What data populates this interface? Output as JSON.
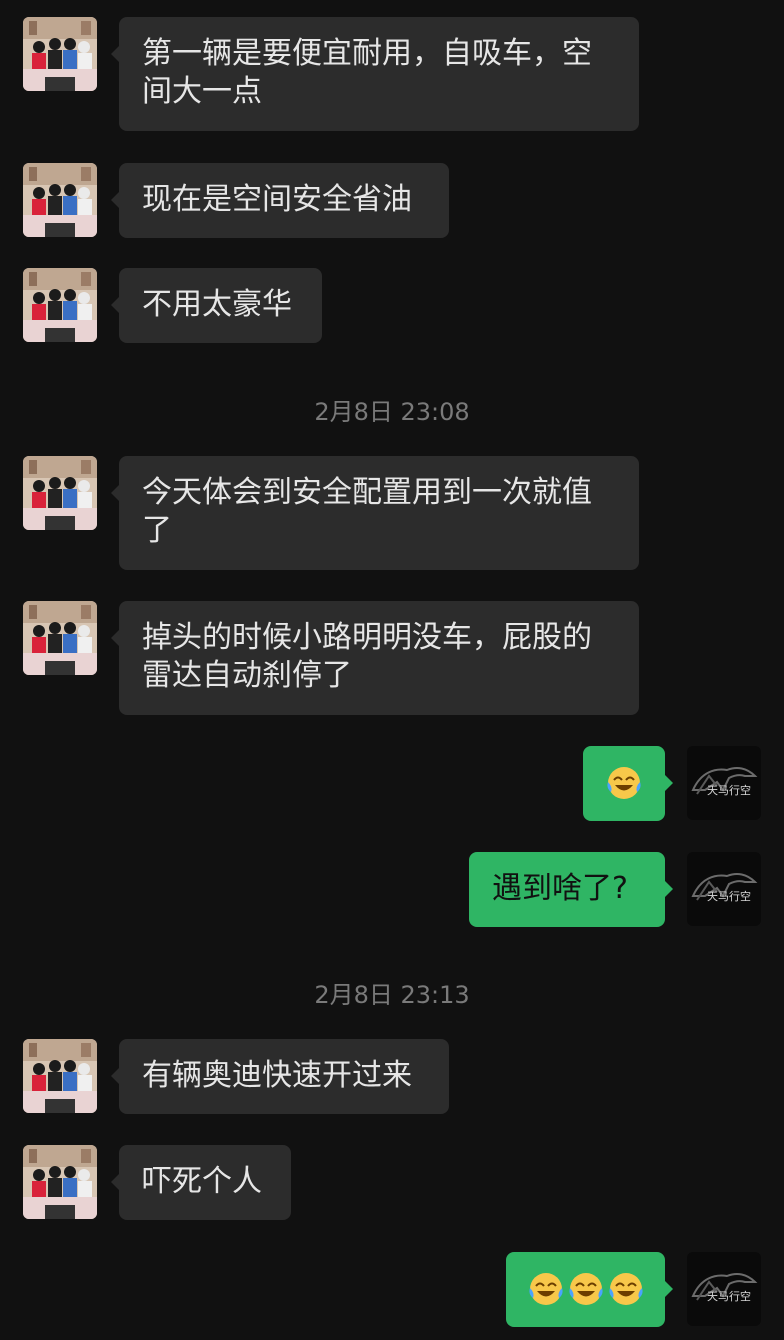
{
  "colors": {
    "background": "#111111",
    "incoming_bubble": "#2c2c2c",
    "outgoing_bubble": "#2fb564",
    "timestamp_text": "#7a7a7a"
  },
  "avatars": {
    "contact": "family-photo-avatar",
    "self": "tianma-horse-logo-avatar",
    "self_logo_text": "天马行空"
  },
  "messages": [
    {
      "side": "in",
      "text": "第一辆是要便宜耐用，自吸车，空间大一点"
    },
    {
      "side": "in",
      "text": "现在是空间安全省油"
    },
    {
      "side": "in",
      "text": "不用太豪华"
    },
    {
      "type": "time",
      "text": "2月8日 23:08"
    },
    {
      "side": "in",
      "text": "今天体会到安全配置用到一次就值了"
    },
    {
      "side": "in",
      "text": "掉头的时候小路明明没车，屁股的雷达自动刹停了"
    },
    {
      "side": "out",
      "emoji": "face-with-tears-of-joy-icon",
      "count": 1
    },
    {
      "side": "out",
      "text": "遇到啥了?"
    },
    {
      "type": "time",
      "text": "2月8日 23:13"
    },
    {
      "side": "in",
      "text": "有辆奥迪快速开过来"
    },
    {
      "side": "in",
      "text": "吓死个人"
    },
    {
      "side": "out",
      "emoji": "face-with-tears-of-joy-icon",
      "count": 3
    }
  ]
}
